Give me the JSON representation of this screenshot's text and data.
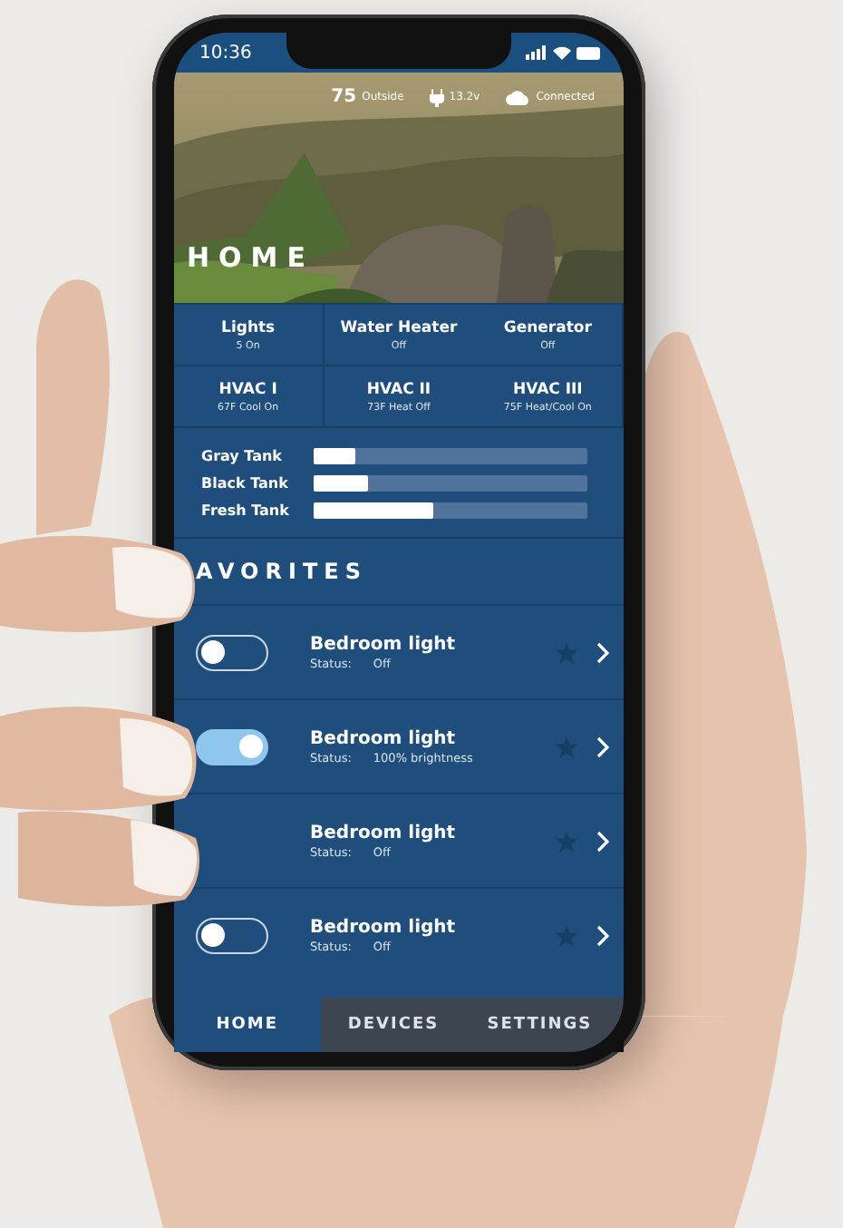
{
  "status_bar": {
    "time": "10:36"
  },
  "hero": {
    "temperature": "75",
    "temperature_label": "Outside",
    "voltage": "13.2v",
    "connection": "Connected",
    "title": "HOME"
  },
  "systems": [
    {
      "name": "Lights",
      "status": "5 On"
    },
    {
      "name": "Water Heater",
      "status": "Off"
    },
    {
      "name": "Generator",
      "status": "Off"
    },
    {
      "name": "HVAC I",
      "status": "67F Cool On"
    },
    {
      "name": "HVAC II",
      "status": "73F Heat Off"
    },
    {
      "name": "HVAC III",
      "status": "75F Heat/Cool On"
    }
  ],
  "tanks": [
    {
      "name": "Gray Tank",
      "level": 0.15
    },
    {
      "name": "Black Tank",
      "level": 0.2
    },
    {
      "name": "Fresh Tank",
      "level": 0.44
    }
  ],
  "favorites": {
    "title": "AVORITES",
    "items": [
      {
        "kind": "toggle",
        "on": false,
        "name": "Bedroom light",
        "status_label": "Status:",
        "status": "Off"
      },
      {
        "kind": "toggle",
        "on": true,
        "name": "Bedroom light",
        "status_label": "Status:",
        "status": "100% brightness"
      },
      {
        "kind": "plain",
        "name": "Bedroom light",
        "status_label": "Status:",
        "status": "Off"
      },
      {
        "kind": "toggle",
        "on": false,
        "name": "Bedroom light",
        "status_label": "Status:",
        "status": "Off"
      }
    ]
  },
  "tabs": [
    {
      "label": "HOME",
      "selected": true
    },
    {
      "label": "DEVICES",
      "selected": false
    },
    {
      "label": "SETTINGS",
      "selected": false
    }
  ]
}
